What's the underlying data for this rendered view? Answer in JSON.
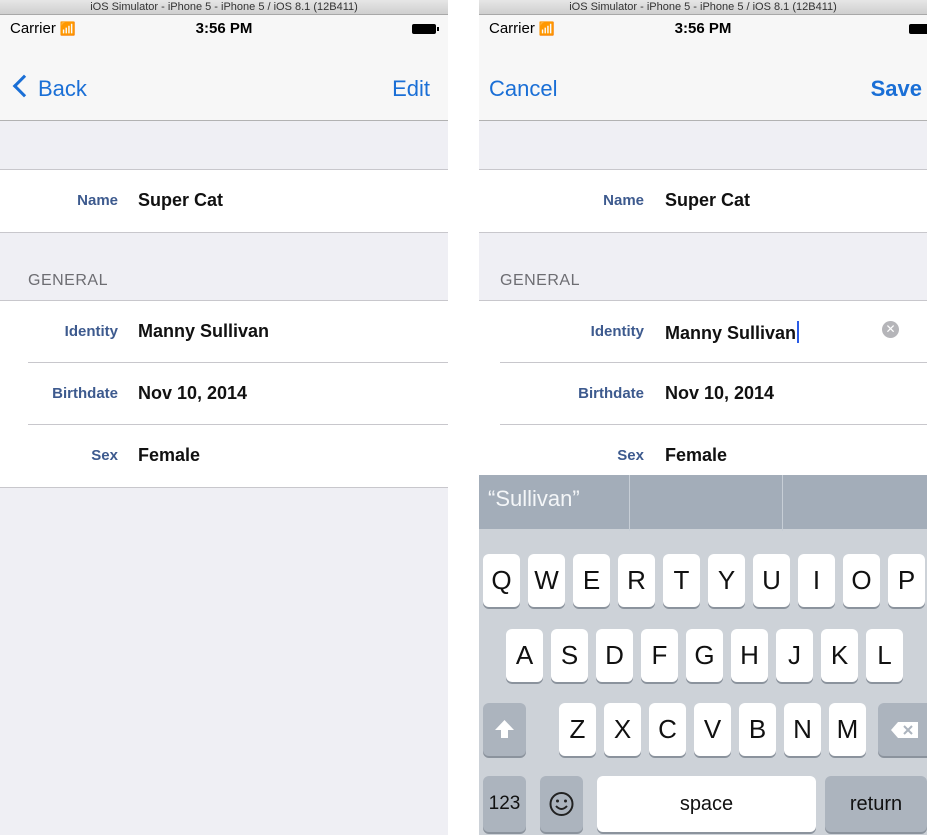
{
  "simulator_title": "iOS Simulator - iPhone 5 - iPhone 5 / iOS 8.1 (12B411)",
  "status": {
    "carrier": "Carrier",
    "time": "3:56 PM"
  },
  "left_screen": {
    "nav": {
      "back_label": "Back",
      "edit_label": "Edit"
    },
    "name_row": {
      "label": "Name",
      "value": "Super Cat"
    },
    "section_title": "GENERAL",
    "rows": [
      {
        "label": "Identity",
        "value": "Manny Sullivan"
      },
      {
        "label": "Birthdate",
        "value": "Nov 10, 2014"
      },
      {
        "label": "Sex",
        "value": "Female"
      }
    ]
  },
  "right_screen": {
    "nav": {
      "cancel_label": "Cancel",
      "save_label": "Save"
    },
    "name_row": {
      "label": "Name",
      "value": "Super Cat"
    },
    "section_title": "GENERAL",
    "rows": [
      {
        "label": "Identity",
        "value": "Manny Sullivan"
      },
      {
        "label": "Birthdate",
        "value": "Nov 10, 2014"
      },
      {
        "label": "Sex",
        "value": "Female"
      }
    ]
  },
  "keyboard": {
    "prediction": "“Sullivan”",
    "row1": [
      "Q",
      "W",
      "E",
      "R",
      "T",
      "Y",
      "U",
      "I",
      "O",
      "P"
    ],
    "row2": [
      "A",
      "S",
      "D",
      "F",
      "G",
      "H",
      "J",
      "K",
      "L"
    ],
    "row3": [
      "Z",
      "X",
      "C",
      "V",
      "B",
      "N",
      "M"
    ],
    "numbers_key": "123",
    "space_key": "space",
    "return_key": "return"
  },
  "icons": [
    "wifi-icon",
    "battery-icon",
    "back-chevron-icon",
    "clear-text-icon",
    "shift-icon",
    "delete-icon",
    "emoji-icon"
  ]
}
